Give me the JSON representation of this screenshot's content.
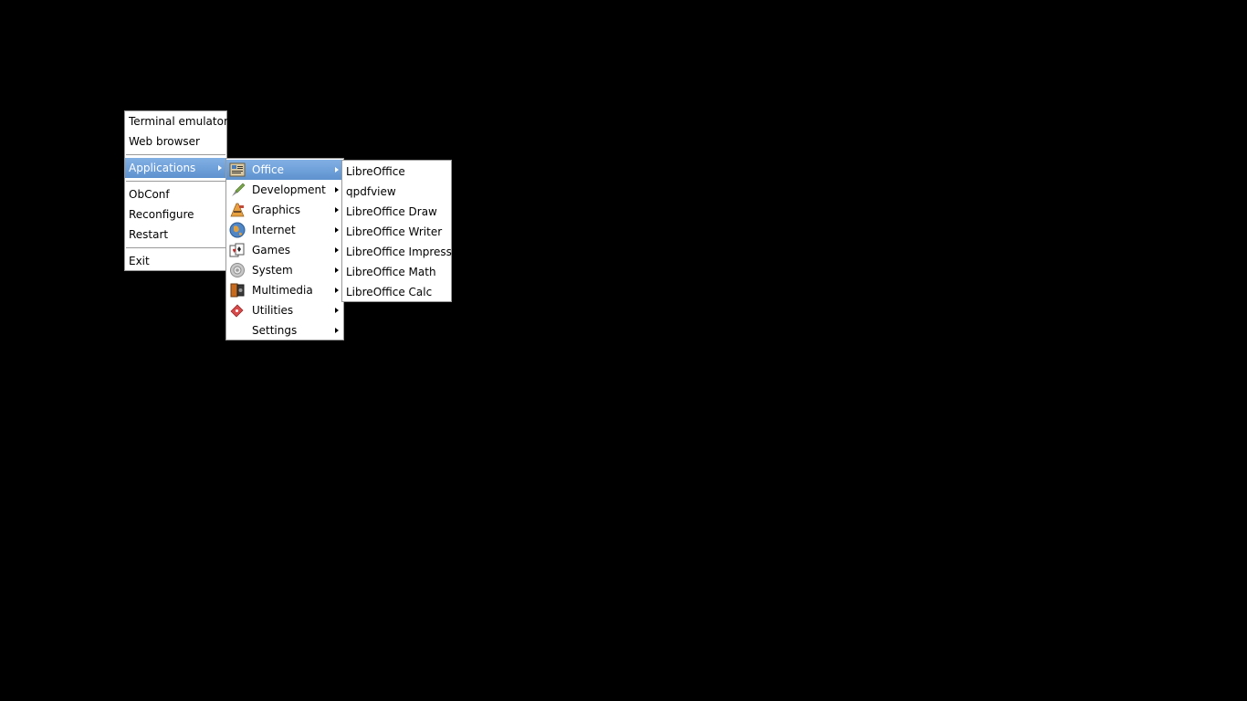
{
  "root_menu": {
    "items": [
      {
        "label": "Terminal emulator"
      },
      {
        "label": "Web browser"
      },
      {
        "label": "Applications"
      },
      {
        "label": "ObConf"
      },
      {
        "label": "Reconfigure"
      },
      {
        "label": "Restart"
      },
      {
        "label": "Exit"
      }
    ]
  },
  "applications_menu": {
    "items": [
      {
        "label": "Office",
        "icon": "office-icon"
      },
      {
        "label": "Development",
        "icon": "development-icon"
      },
      {
        "label": "Graphics",
        "icon": "graphics-icon"
      },
      {
        "label": "Internet",
        "icon": "internet-globe-icon"
      },
      {
        "label": "Games",
        "icon": "games-cards-icon"
      },
      {
        "label": "System",
        "icon": "system-gear-icon"
      },
      {
        "label": "Multimedia",
        "icon": "multimedia-icon"
      },
      {
        "label": "Utilities",
        "icon": "utilities-icon"
      },
      {
        "label": "Settings",
        "icon": ""
      }
    ]
  },
  "office_menu": {
    "items": [
      {
        "label": "LibreOffice"
      },
      {
        "label": "qpdfview"
      },
      {
        "label": "LibreOffice Draw"
      },
      {
        "label": "LibreOffice Writer"
      },
      {
        "label": "LibreOffice Impress"
      },
      {
        "label": "LibreOffice Math"
      },
      {
        "label": "LibreOffice Calc"
      }
    ]
  },
  "colors": {
    "desktop_background": "#000000",
    "highlight": "#6fa0d8",
    "menu_background": "#ffffff",
    "menu_border": "#9a9a9a"
  }
}
